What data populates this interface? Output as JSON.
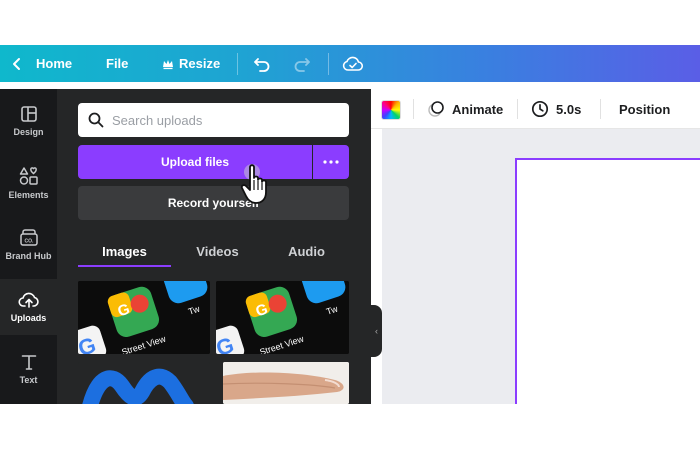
{
  "topbar": {
    "home_label": "Home",
    "file_label": "File",
    "resize_label": "Resize"
  },
  "rail": {
    "items": [
      {
        "label": "Design",
        "icon": "layout-icon"
      },
      {
        "label": "Elements",
        "icon": "shapes-icon"
      },
      {
        "label": "Brand Hub",
        "icon": "brand-icon"
      },
      {
        "label": "Uploads",
        "icon": "cloud-upload-icon"
      },
      {
        "label": "Text",
        "icon": "text-icon"
      }
    ],
    "active": "Uploads"
  },
  "panel": {
    "search_placeholder": "Search uploads",
    "upload_label": "Upload files",
    "record_label": "Record yourself",
    "tabs": [
      "Images",
      "Videos",
      "Audio"
    ],
    "active_tab": "Images",
    "thumb_labels": {
      "street_view": "Street View",
      "tw": "Tw"
    }
  },
  "editor": {
    "animate_label": "Animate",
    "duration_label": "5.0s",
    "position_label": "Position"
  },
  "colors": {
    "accent": "#8b3dff",
    "topbar_start": "#0fb8cc",
    "topbar_end": "#5a5ee6",
    "rail_bg": "#18191b",
    "panel_bg": "#252627"
  }
}
